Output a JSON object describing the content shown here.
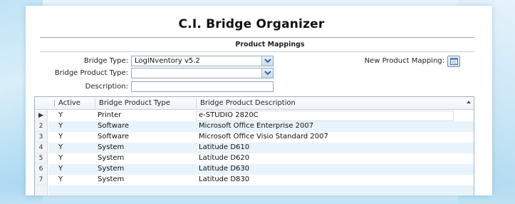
{
  "title": "C.I. Bridge Organizer",
  "section_title": "Product Mappings",
  "form": {
    "bridge_type_label": "Bridge Type:",
    "bridge_type_value": "LogINventory v5.2",
    "bridge_product_type_label": "Bridge Product Type:",
    "bridge_product_type_value": "",
    "description_label": "Description:",
    "description_value": "",
    "new_product_mapping_label": "New Product Mapping:"
  },
  "grid": {
    "columns": [
      "Active",
      "Bridge Product Type",
      "Bridge Product Description"
    ],
    "rows": [
      {
        "marker": "▶",
        "active": "Y",
        "type": "Printer",
        "description": "e-STUDIO 2820C"
      },
      {
        "marker": "2",
        "active": "Y",
        "type": "Software",
        "description": "Microsoft Office Enterprise 2007"
      },
      {
        "marker": "3",
        "active": "Y",
        "type": "Software",
        "description": "Microsoft Office Visio Standard 2007"
      },
      {
        "marker": "4",
        "active": "Y",
        "type": "System",
        "description": "Latitude D610"
      },
      {
        "marker": "5",
        "active": "Y",
        "type": "System",
        "description": "Latitude D620"
      },
      {
        "marker": "6",
        "active": "Y",
        "type": "System",
        "description": "Latitude D630"
      },
      {
        "marker": "7",
        "active": "Y",
        "type": "System",
        "description": "Latitude D830"
      }
    ]
  },
  "icons": {
    "dropdown": "chevron-down-icon",
    "new_mapping": "new-record-icon",
    "current_row": "row-pointer-icon",
    "scroll_up": "scroll-up-arrow-icon"
  },
  "colors": {
    "accent_dropdown": "#2f64b0",
    "row_alt": "#e9f3fb",
    "border": "#8fa7bd"
  }
}
